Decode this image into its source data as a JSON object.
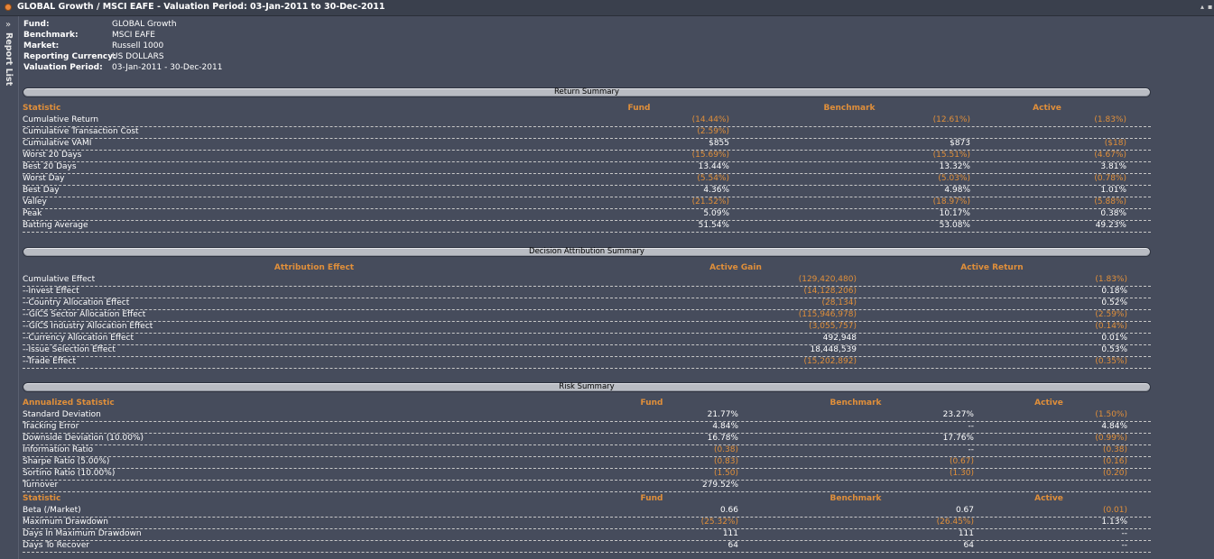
{
  "window": {
    "title": "GLOBAL Growth / MSCI EAFE - Valuation Period: 03-Jan-2011 to 30-Dec-2011",
    "report_list_label": "Report List"
  },
  "info": [
    {
      "key": "Fund:",
      "value": "GLOBAL Growth"
    },
    {
      "key": "Benchmark:",
      "value": "MSCI EAFE"
    },
    {
      "key": "Market:",
      "value": "Russell 1000"
    },
    {
      "key": "Reporting Currency:",
      "value": "US DOLLARS"
    },
    {
      "key": "Valuation Period:",
      "value": "03-Jan-2011 - 30-Dec-2011"
    }
  ],
  "return_summary": {
    "title": "Return Summary",
    "headers": [
      "Statistic",
      "Fund",
      "Benchmark",
      "Active"
    ],
    "rows": [
      {
        "label": "Cumulative Return",
        "fund": "(14.44%)",
        "bench": "(12.61%)",
        "active": "(1.83%)"
      },
      {
        "label": "Cumulative Transaction Cost",
        "fund": "(2.59%)",
        "bench": "",
        "active": ""
      },
      {
        "label": "Cumulative VAMI",
        "fund": "$855",
        "bench": "$873",
        "active": "($18)"
      },
      {
        "label": "Worst 20 Days",
        "fund": "(15.69%)",
        "bench": "(15.51%)",
        "active": "(4.67%)"
      },
      {
        "label": "Best 20 Days",
        "fund": "13.44%",
        "bench": "13.32%",
        "active": "3.81%"
      },
      {
        "label": "Worst Day",
        "fund": "(5.54%)",
        "bench": "(5.03%)",
        "active": "(0.78%)"
      },
      {
        "label": "Best Day",
        "fund": "4.36%",
        "bench": "4.98%",
        "active": "1.01%"
      },
      {
        "label": "Valley",
        "fund": "(21.52%)",
        "bench": "(18.97%)",
        "active": "(5.88%)"
      },
      {
        "label": "Peak",
        "fund": "5.09%",
        "bench": "10.17%",
        "active": "0.38%"
      },
      {
        "label": "Batting Average",
        "fund": "51.54%",
        "bench": "53.08%",
        "active": "49.23%"
      }
    ]
  },
  "decision_summary": {
    "title": "Decision Attribution Summary",
    "headers": [
      "Attribution Effect",
      "Active Gain",
      "Active Return"
    ],
    "rows": [
      {
        "label": "Cumulative Effect",
        "gain": "(129,420,480)",
        "ret": "(1.83%)"
      },
      {
        "label": "--Invest Effect",
        "gain": "(14,128,206)",
        "ret": "0.18%"
      },
      {
        "label": "--Country Allocation Effect",
        "gain": "(28,134)",
        "ret": "0.52%"
      },
      {
        "label": "--GICS Sector Allocation Effect",
        "gain": "(115,946,978)",
        "ret": "(2.59%)"
      },
      {
        "label": "--GICS Industry Allocation Effect",
        "gain": "(3,055,757)",
        "ret": "(0.14%)"
      },
      {
        "label": "--Currency Allocation Effect",
        "gain": "492,948",
        "ret": "0.01%"
      },
      {
        "label": "--Issue Selection Effect",
        "gain": "18,448,539",
        "ret": "0.53%"
      },
      {
        "label": "--Trade Effect",
        "gain": "(15,202,892)",
        "ret": "(0.35%)"
      }
    ]
  },
  "risk_summary": {
    "title": "Risk Summary",
    "headers1": [
      "Annualized Statistic",
      "Fund",
      "Benchmark",
      "Active"
    ],
    "rows1": [
      {
        "label": "Standard Deviation",
        "fund": "21.77%",
        "bench": "23.27%",
        "active": "(1.50%)"
      },
      {
        "label": "Tracking Error",
        "fund": "4.84%",
        "bench": "--",
        "active": "4.84%"
      },
      {
        "label": "Downside Deviation (10.00%)",
        "fund": "16.78%",
        "bench": "17.76%",
        "active": "(0.99%)"
      },
      {
        "label": "Information Ratio",
        "fund": "(0.38)",
        "bench": "--",
        "active": "(0.38)"
      },
      {
        "label": "Sharpe Ratio (5.00%)",
        "fund": "(0.83)",
        "bench": "(0.67)",
        "active": "(0.16)"
      },
      {
        "label": "Sortino Ratio (10.00%)",
        "fund": "(1.50)",
        "bench": "(1.30)",
        "active": "(0.20)"
      },
      {
        "label": "Turnover",
        "fund": "279.52%",
        "bench": "",
        "active": ""
      }
    ],
    "headers2": [
      "Statistic",
      "Fund",
      "Benchmark",
      "Active"
    ],
    "rows2": [
      {
        "label": "Beta (/Market)",
        "fund": "0.66",
        "bench": "0.67",
        "active": "(0.01)"
      },
      {
        "label": "Maximum Drawdown",
        "fund": "(25.32%)",
        "bench": "(26.45%)",
        "active": "1.13%"
      },
      {
        "label": "Days In Maximum Drawdown",
        "fund": "111",
        "bench": "111",
        "active": "--"
      },
      {
        "label": "Days To Recover",
        "fund": "64",
        "bench": "64",
        "active": "--"
      }
    ]
  },
  "colors": {
    "accent": "#e08f3a",
    "background": "#464c5c",
    "banner": "#b9bcc3"
  }
}
